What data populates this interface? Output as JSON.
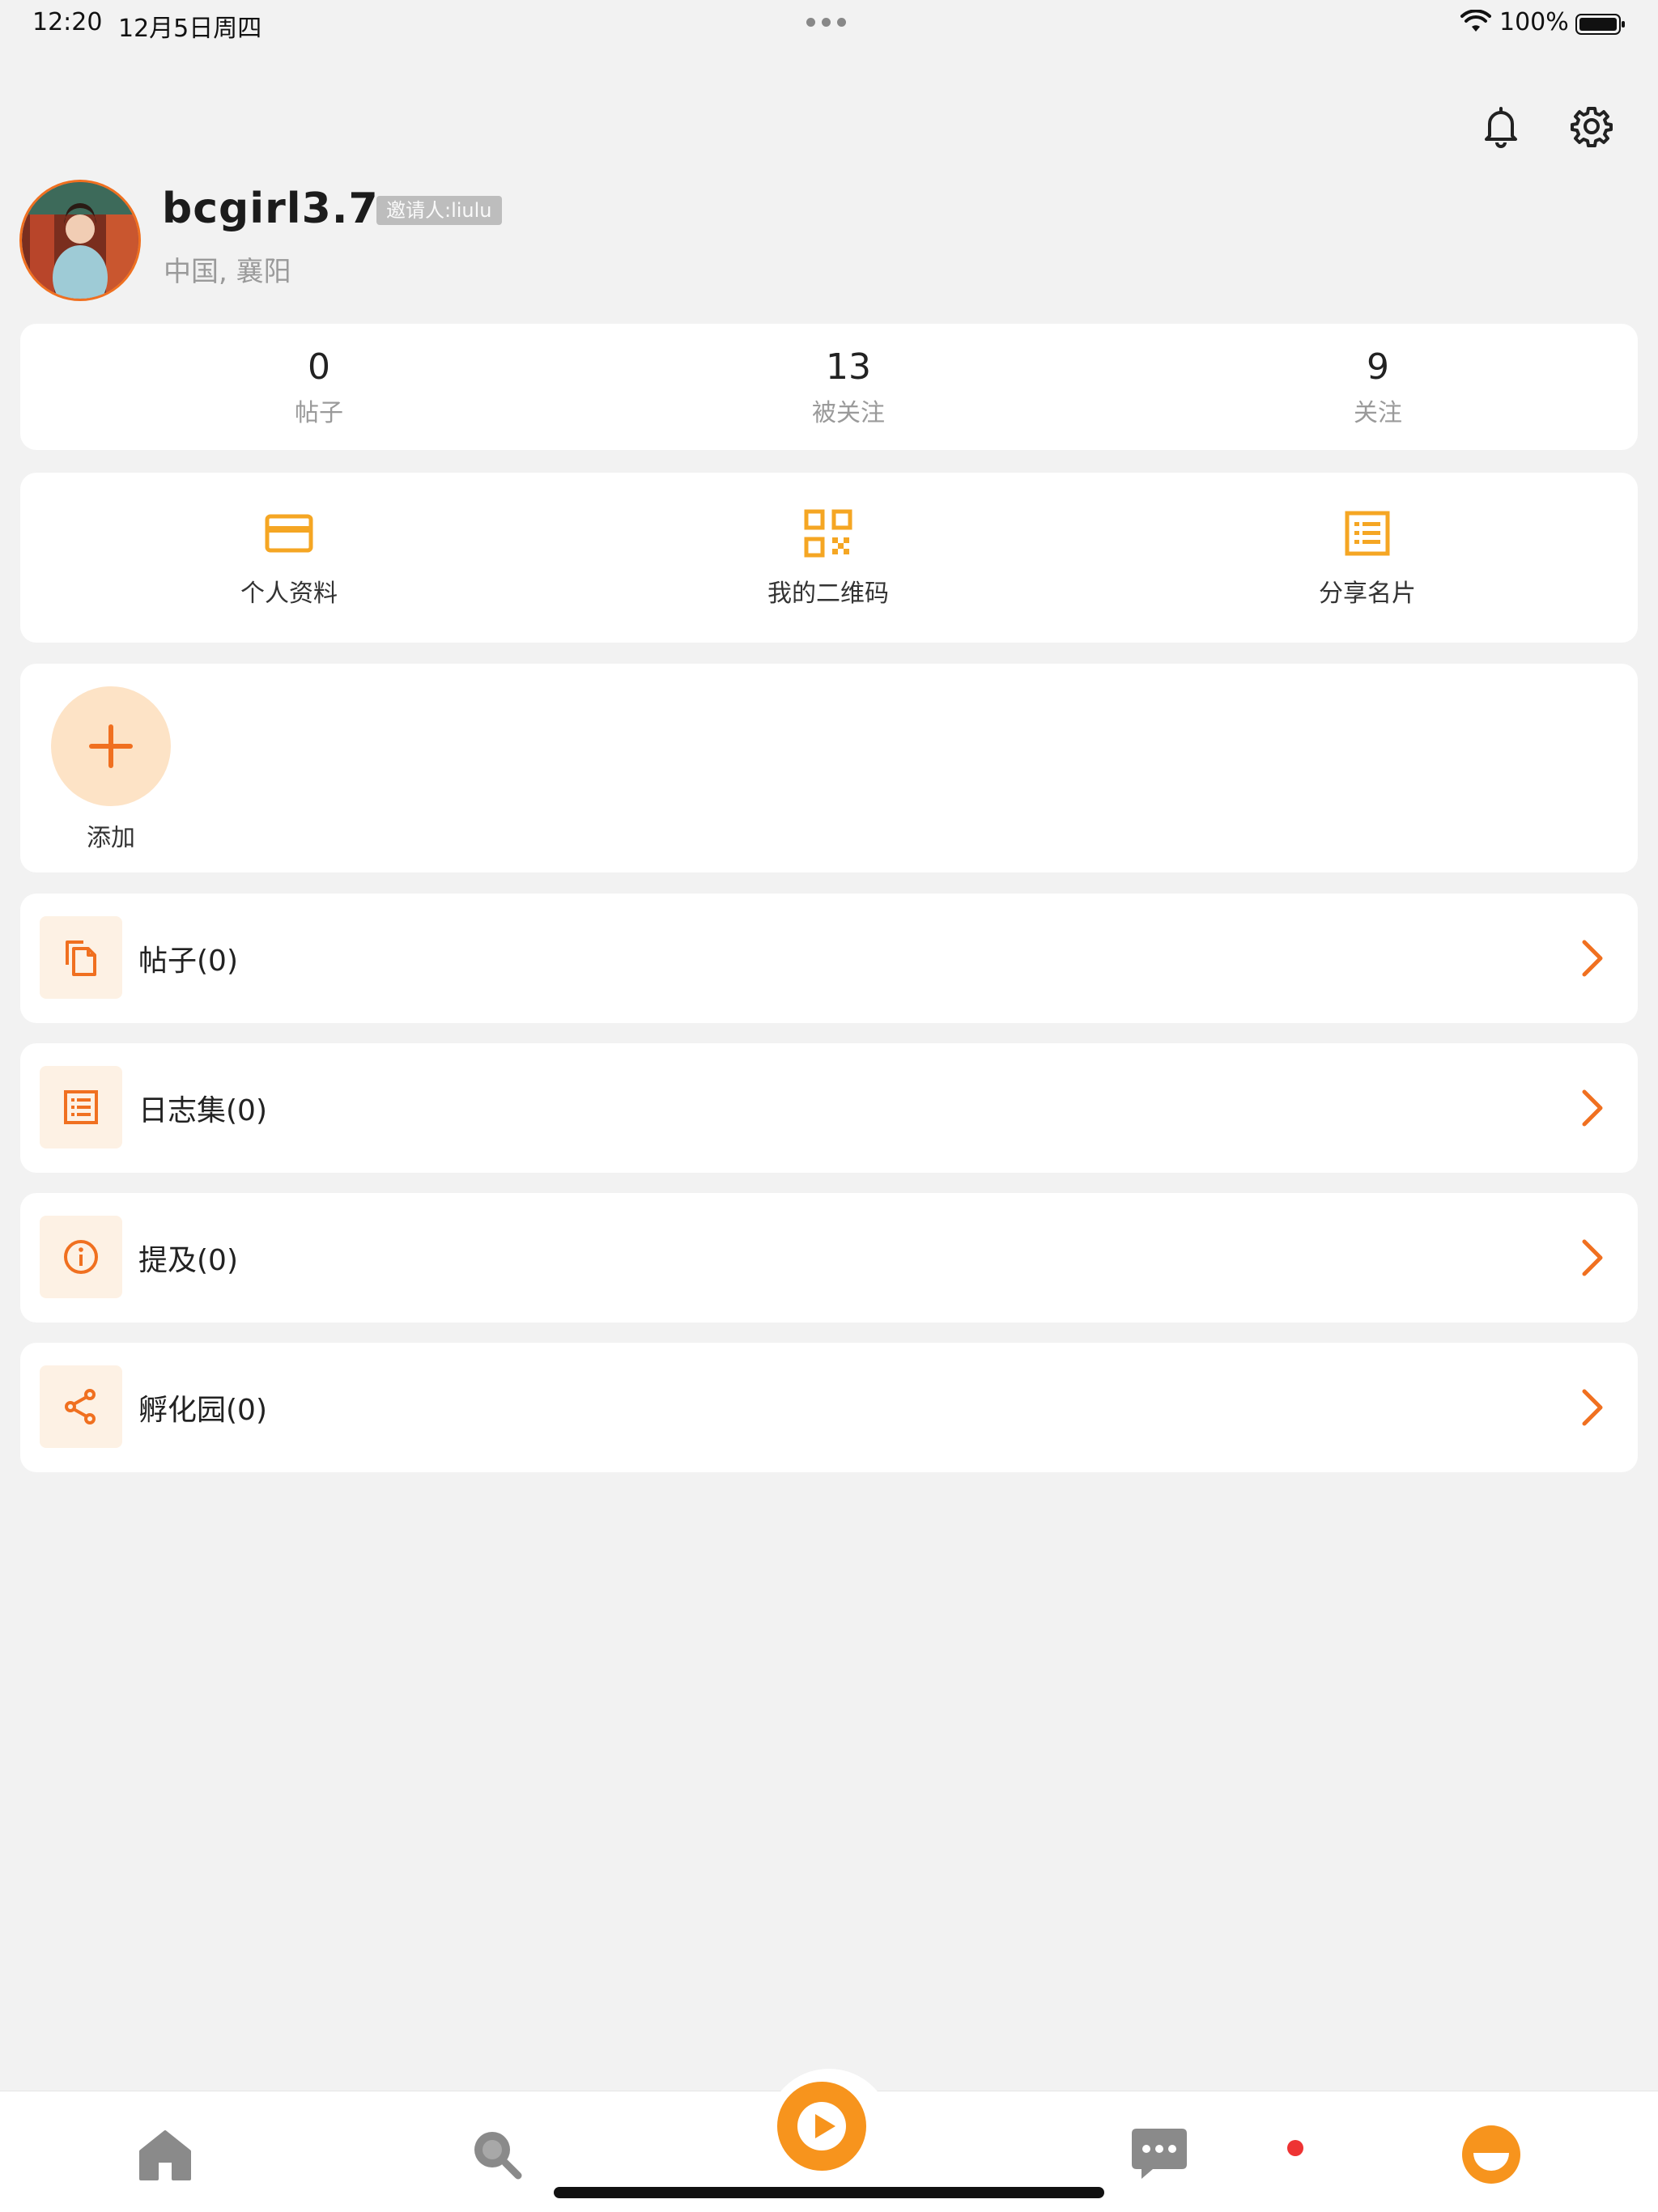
{
  "status_bar": {
    "time": "12:20",
    "date": "12月5日周四",
    "battery": "100%"
  },
  "header": {
    "icons": [
      "bell-icon",
      "gear-icon"
    ]
  },
  "profile": {
    "username": "bcgirl3.7",
    "inviter": "邀请人:liulu",
    "location": "中国, 襄阳"
  },
  "stats": [
    {
      "value": "0",
      "label": "帖子"
    },
    {
      "value": "13",
      "label": "被关注"
    },
    {
      "value": "9",
      "label": "关注"
    }
  ],
  "quick_actions": [
    {
      "label": "个人资料",
      "icon": "card-icon"
    },
    {
      "label": "我的二维码",
      "icon": "qr-code-icon"
    },
    {
      "label": "分享名片",
      "icon": "list-card-icon"
    }
  ],
  "add": {
    "label": "添加"
  },
  "menu": [
    {
      "label": "帖子(0)",
      "icon": "copy-icon"
    },
    {
      "label": "日志集(0)",
      "icon": "list-icon"
    },
    {
      "label": "提及(0)",
      "icon": "info-icon"
    },
    {
      "label": "孵化园(0)",
      "icon": "share-icon"
    }
  ],
  "tabbar": {
    "items": [
      "home-icon",
      "search-icon",
      "play-icon",
      "chat-icon",
      "profile-icon"
    ]
  },
  "colors": {
    "accent": "#f07020",
    "orange": "#f7941d",
    "gold": "#f5a623",
    "background": "#f2f2f2"
  }
}
